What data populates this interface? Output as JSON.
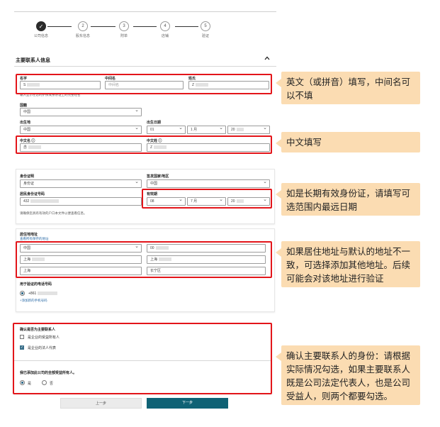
{
  "stepper": {
    "steps": [
      {
        "num": "✓",
        "label": "公司信息",
        "done": true
      },
      {
        "num": "2",
        "label": "股东信息",
        "done": false
      },
      {
        "num": "3",
        "label": "附单",
        "done": false
      },
      {
        "num": "4",
        "label": "店铺",
        "done": false
      },
      {
        "num": "5",
        "label": "验证",
        "done": false
      }
    ]
  },
  "section": {
    "title": "主要联系人信息"
  },
  "name_fields": {
    "first_label": "名字",
    "first_value": "S",
    "middle_label": "中间名",
    "middle_value": "中间名",
    "last_label": "姓氏",
    "last_value": "Z",
    "hint": "输入显示在您的护照或身份证上的完整姓名"
  },
  "nationality": {
    "label": "国籍",
    "value": "中国"
  },
  "birth_place": {
    "label": "出生地",
    "value": "中国"
  },
  "birth_date": {
    "label": "出生日期",
    "day": "01",
    "month": "1 月",
    "year": "20"
  },
  "cn_name": {
    "first_label": "中文名",
    "first_value": "念",
    "last_label": "中文姓",
    "last_value": "Z"
  },
  "id_doc": {
    "type_label": "身份证明",
    "type_value": "身份证",
    "country_label": "签发国家/地区",
    "country_value": "中国",
    "number_label": "居民身份证号码",
    "number_value": "432",
    "expiry_label": "有效期",
    "expiry_day": "08",
    "expiry_month": "7 月",
    "expiry_year": "20",
    "hint": "请确保您具有有效的户口本文件以便查看信息。"
  },
  "address": {
    "label": "居住地地址",
    "link": "查看所有保存的地址",
    "country": "中国",
    "postcode": "00",
    "province": "上海",
    "line2": "上海",
    "city": "上海",
    "district": "长宁区"
  },
  "phone": {
    "label": "用于验证的电话号码",
    "value": "+861",
    "add_link": "+添加新的手机号码"
  },
  "confirm": {
    "title": "确认是否为主要联系人",
    "opt1": "是企业的受益所有人",
    "opt2": "是企业的法人代表",
    "opt1_checked": false,
    "opt2_checked": true
  },
  "beneficiary": {
    "title": "我已添加此公司的全部受益所有人。",
    "yes": "是",
    "no": "否"
  },
  "buttons": {
    "prev": "上一步",
    "next": "下一步"
  },
  "notes": {
    "n1": "英文（或拼音）填写，中间名可以不填",
    "n2": "中文填写",
    "n3": "如是长期有效身份证，请填写可选范围内最远日期",
    "n4": "如果居住地址与默认的地址不一致，可选择添加其他地址。后续可能会对该地址进行验证",
    "n5": "确认主要联系人的身份：请根据实际情况勾选，如果主要联系人既是公司法定代表人，也是公司受益人，则两个都要勾选。"
  },
  "colors": {
    "highlight_red": "#e3151a",
    "note_bg": "#fbdcb2",
    "primary_button": "#0f6275"
  }
}
